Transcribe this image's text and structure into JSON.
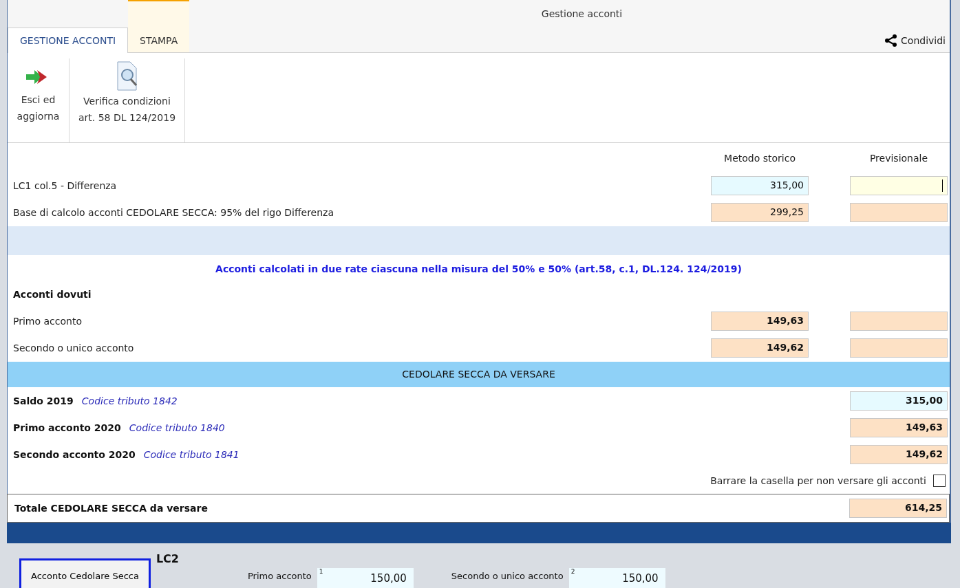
{
  "window": {
    "title": "Gestione acconti",
    "share": "Condividi"
  },
  "tabs": [
    {
      "label": "GESTIONE ACCONTI",
      "selected": true
    },
    {
      "label": "STAMPA",
      "selected": false
    }
  ],
  "ribbon": [
    {
      "kind": "exit",
      "label": "Esci ed aggiorna"
    },
    {
      "kind": "verify",
      "label": "Verifica condizioni art. 58 DL 124/2019"
    }
  ],
  "columns": [
    "Metodo storico",
    "Previsionale"
  ],
  "base_rows": [
    {
      "label": "LC1 col.5 - Differenza",
      "fields": [
        {
          "value": "315,00",
          "kind": "entry"
        },
        {
          "kind": "focused"
        }
      ]
    },
    {
      "label": "Base di calcolo acconti CEDOLARE SECCA: 95% del rigo Differenza",
      "fields": [
        {
          "value": "299,25",
          "kind": "computed"
        },
        {
          "kind": "computed"
        }
      ]
    }
  ],
  "note": "Acconti calcolati in due rate ciascuna nella misura del 50% e 50% (art.58, c.1, DL.124. 124/2019)",
  "due": {
    "title": "Acconti dovuti",
    "rows": [
      {
        "label": "Primo acconto",
        "fields": [
          {
            "value": "149,63",
            "kind": "computed"
          },
          {
            "kind": "computed"
          }
        ]
      },
      {
        "label": "Secondo o unico acconto",
        "fields": [
          {
            "value": "149,62",
            "kind": "computed"
          },
          {
            "kind": "computed"
          }
        ]
      }
    ]
  },
  "pay": {
    "title": "CEDOLARE SECCA DA VERSARE",
    "rows": [
      {
        "label": "Saldo 2019",
        "code": "Codice tributo 1842",
        "value": "315,00",
        "kind": "entry"
      },
      {
        "label": "Primo acconto 2020",
        "code": "Codice tributo 1840",
        "value": "149,63",
        "kind": "computed"
      },
      {
        "label": "Secondo acconto 2020",
        "code": "Codice tributo 1841",
        "value": "149,62",
        "kind": "computed"
      }
    ],
    "skip_label": "Barrare la casella per non versare gli acconti",
    "skip_checked": false,
    "total_label": "Totale CEDOLARE SECCA da versare",
    "total": "614,25"
  },
  "background": {
    "button": "Acconto Cedolare Secca",
    "section": "LC2",
    "fields": [
      {
        "label": "Primo acconto",
        "index": "1",
        "value": "150,00"
      },
      {
        "label": "Secondo o unico acconto",
        "index": "2",
        "value": "150,00"
      }
    ]
  }
}
